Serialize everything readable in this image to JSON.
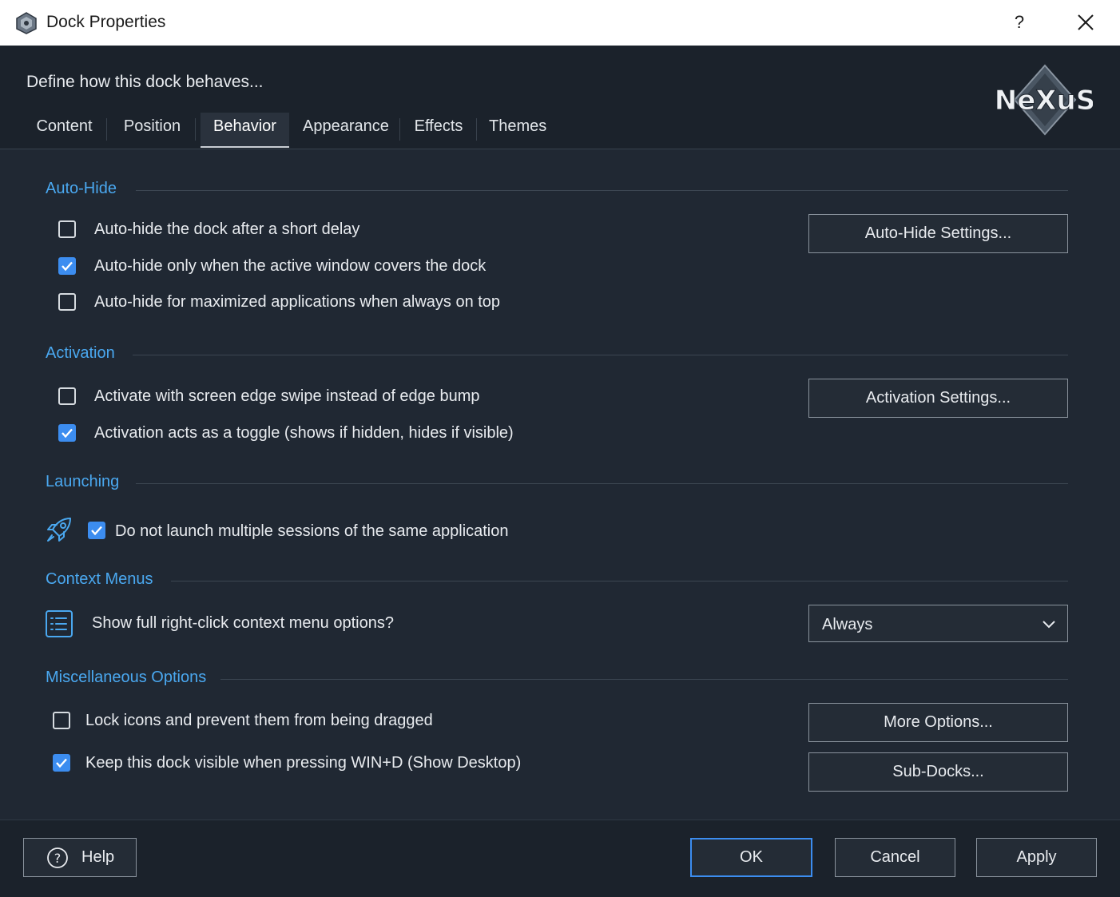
{
  "window": {
    "title": "Dock Properties",
    "help_glyph": "?"
  },
  "header": {
    "subtitle": "Define how this dock behaves...",
    "logo_text": "NeXuS"
  },
  "tabs": [
    {
      "label": "Content",
      "active": false
    },
    {
      "label": "Position",
      "active": false
    },
    {
      "label": "Behavior",
      "active": true
    },
    {
      "label": "Appearance",
      "active": false
    },
    {
      "label": "Effects",
      "active": false
    },
    {
      "label": "Themes",
      "active": false
    }
  ],
  "sections": {
    "autohide": {
      "title": "Auto-Hide",
      "options": [
        {
          "label": "Auto-hide the dock after a short delay",
          "checked": false
        },
        {
          "label": "Auto-hide only when the active window covers the dock",
          "checked": true
        },
        {
          "label": "Auto-hide for maximized applications when always on top",
          "checked": false
        }
      ],
      "button": "Auto-Hide Settings..."
    },
    "activation": {
      "title": "Activation",
      "options": [
        {
          "label": "Activate with screen edge swipe instead of edge bump",
          "checked": false
        },
        {
          "label": "Activation acts as a toggle (shows if hidden, hides if visible)",
          "checked": true
        }
      ],
      "button": "Activation Settings..."
    },
    "launching": {
      "title": "Launching",
      "options": [
        {
          "label": "Do not launch multiple sessions of the same application",
          "checked": true
        }
      ]
    },
    "context": {
      "title": "Context Menus",
      "question": "Show full right-click context menu options?",
      "selected": "Always"
    },
    "misc": {
      "title": "Miscellaneous Options",
      "options": [
        {
          "label": "Lock icons and prevent them from being dragged",
          "checked": false
        },
        {
          "label": "Keep this dock visible when pressing WIN+D (Show Desktop)",
          "checked": true
        }
      ],
      "buttons": [
        "More Options...",
        "Sub-Docks..."
      ]
    }
  },
  "footer": {
    "help": "Help",
    "ok": "OK",
    "cancel": "Cancel",
    "apply": "Apply"
  },
  "colors": {
    "accent": "#3c8df0",
    "section_title": "#4aa8f0",
    "background": "#202833"
  }
}
